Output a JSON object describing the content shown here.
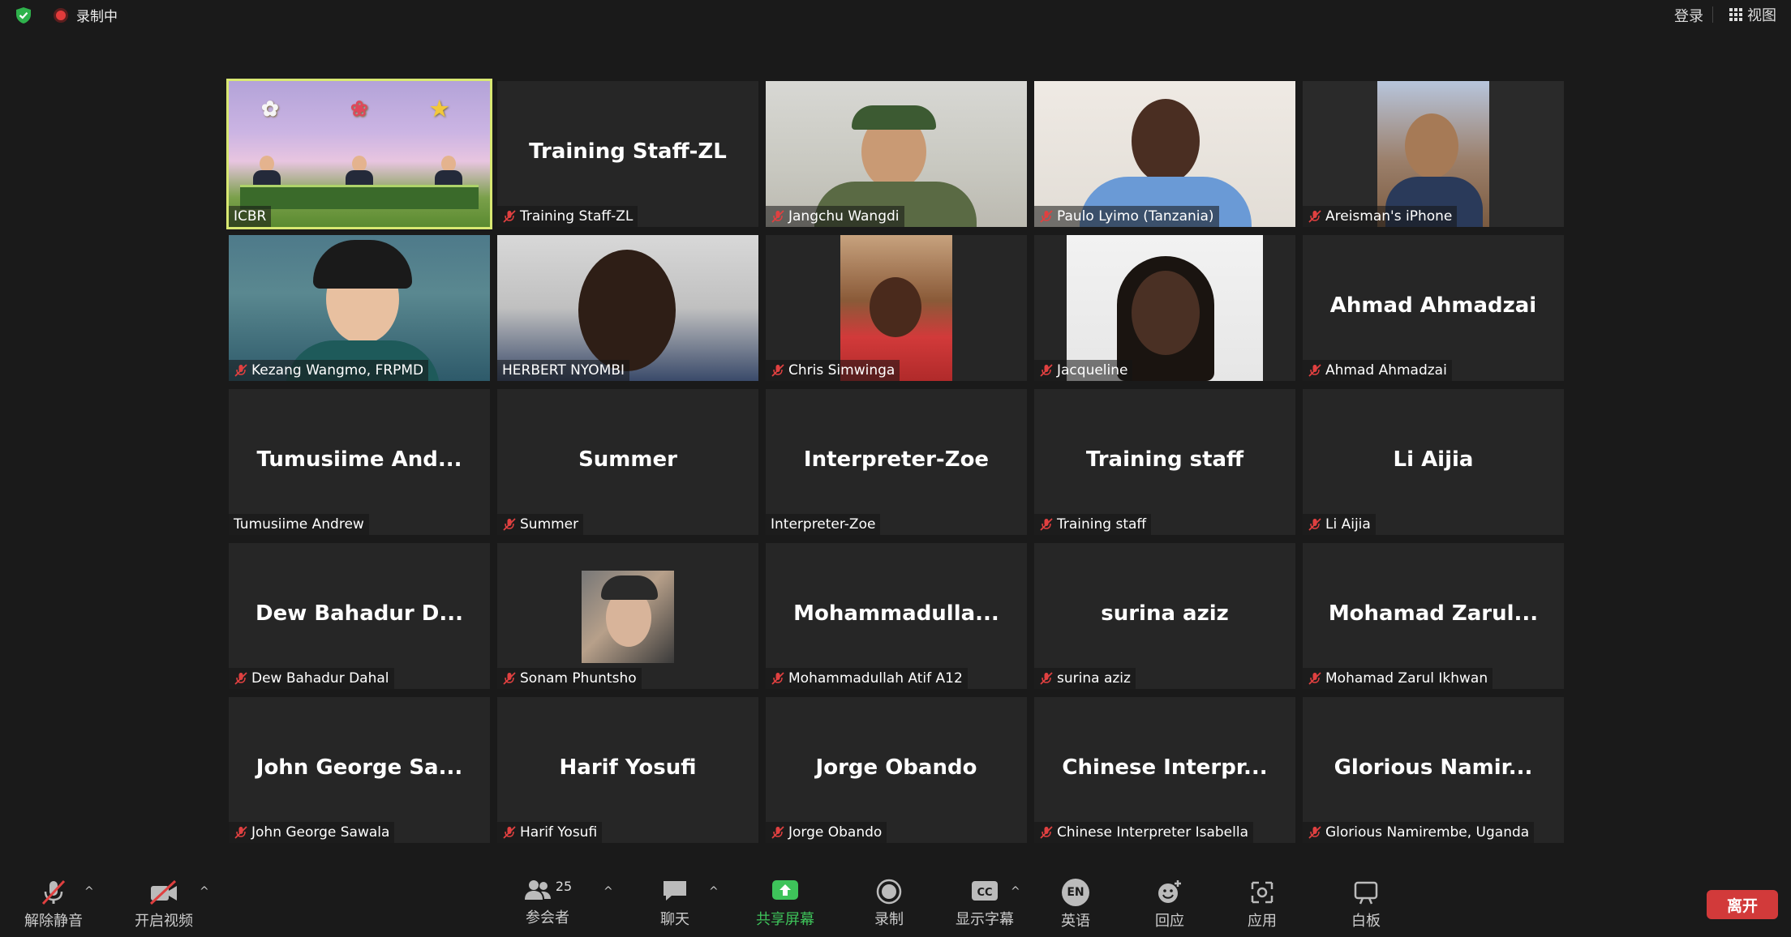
{
  "topbar": {
    "recording_label": "录制中",
    "login_label": "登录",
    "view_label": "视图"
  },
  "tiles": [
    {
      "name": "ICBR",
      "big": "",
      "muted": false,
      "video": "icbr"
    },
    {
      "name": "Training Staff-ZL",
      "big": "Training Staff-ZL",
      "muted": true,
      "video": ""
    },
    {
      "name": "Jangchu Wangdi",
      "big": "",
      "muted": true,
      "video": "jangchu"
    },
    {
      "name": "Paulo Lyimo (Tanzania)",
      "big": "",
      "muted": true,
      "video": "paulo"
    },
    {
      "name": "Areisman's iPhone",
      "big": "",
      "muted": true,
      "video": "areis"
    },
    {
      "name": "Kezang Wangmo, FRPMD",
      "big": "",
      "muted": true,
      "video": "kezang"
    },
    {
      "name": "HERBERT NYOMBI",
      "big": "",
      "muted": false,
      "video": "herbert"
    },
    {
      "name": "Chris Simwinga",
      "big": "",
      "muted": true,
      "video": "chris"
    },
    {
      "name": "Jacqueline",
      "big": "",
      "muted": true,
      "video": "jacq"
    },
    {
      "name": "Ahmad Ahmadzai",
      "big": "Ahmad Ahmadzai",
      "muted": true,
      "video": ""
    },
    {
      "name": "Tumusiime Andrew",
      "big": "Tumusiime  And...",
      "muted": false,
      "video": ""
    },
    {
      "name": "Summer",
      "big": "Summer",
      "muted": true,
      "video": ""
    },
    {
      "name": "Interpreter-Zoe",
      "big": "Interpreter-Zoe",
      "muted": false,
      "video": ""
    },
    {
      "name": "Training staff",
      "big": "Training staff",
      "muted": true,
      "video": ""
    },
    {
      "name": "Li Aijia",
      "big": "Li Aijia",
      "muted": true,
      "video": ""
    },
    {
      "name": "Dew Bahadur Dahal",
      "big": "Dew  Bahadur  D...",
      "muted": true,
      "video": ""
    },
    {
      "name": "Sonam Phuntsho",
      "big": "",
      "muted": true,
      "video": "sonam"
    },
    {
      "name": "Mohammadullah Atif  A12",
      "big": "Mohammadulla...",
      "muted": true,
      "video": ""
    },
    {
      "name": "surina aziz",
      "big": "surina aziz",
      "muted": true,
      "video": ""
    },
    {
      "name": "Mohamad Zarul Ikhwan",
      "big": "Mohamad  Zarul...",
      "muted": true,
      "video": ""
    },
    {
      "name": "John George Sawala",
      "big": "John  George  Sa...",
      "muted": true,
      "video": ""
    },
    {
      "name": "Harif Yosufi",
      "big": "Harif Yosufi",
      "muted": true,
      "video": ""
    },
    {
      "name": "Jorge Obando",
      "big": "Jorge Obando",
      "muted": true,
      "video": ""
    },
    {
      "name": "Chinese Interpreter Isabella",
      "big": "Chinese  Interpr...",
      "muted": true,
      "video": ""
    },
    {
      "name": "Glorious Namirembe, Uganda",
      "big": "Glorious  Namir...",
      "muted": true,
      "video": ""
    }
  ],
  "toolbar": {
    "unmute": "解除静音",
    "start_video": "开启视频",
    "participants": "参会者",
    "participant_count": "25",
    "chat": "聊天",
    "share": "共享屏幕",
    "record": "录制",
    "captions": "显示字幕",
    "language_badge": "EN",
    "language": "英语",
    "reactions": "回应",
    "apps": "应用",
    "whiteboard": "白板",
    "leave": "离开"
  },
  "colors": {
    "share_green": "#3ec35a",
    "leave_red": "#d23a3a",
    "active_speaker": "#d8e872",
    "mute_red": "#e04040"
  }
}
